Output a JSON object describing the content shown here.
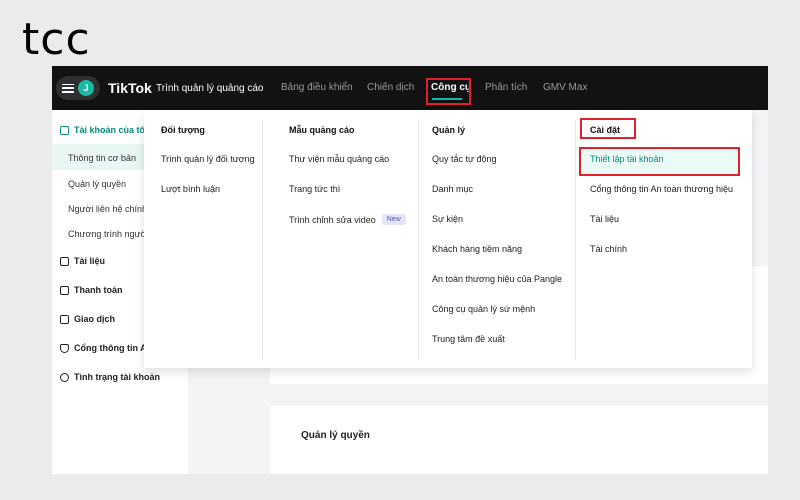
{
  "logo": "tcc",
  "header": {
    "avatar_initial": "J",
    "brand": "TikTok",
    "brand_sub": "Trình quản lý quảng cáo",
    "nav": [
      {
        "label": "Bảng điều khiển"
      },
      {
        "label": "Chiến dịch"
      },
      {
        "label": "Công cụ"
      },
      {
        "label": "Phân tích"
      },
      {
        "label": "GMV Max"
      }
    ]
  },
  "sidebar": {
    "section_title": "Tài khoản của tôi",
    "sub_items": [
      {
        "label": "Thông tin cơ bản"
      },
      {
        "label": "Quản lý quyền"
      },
      {
        "label": "Người liên hệ chính"
      },
      {
        "label": "Chương trình người"
      }
    ],
    "items": [
      {
        "label": "Tài liệu"
      },
      {
        "label": "Thanh toán"
      },
      {
        "label": "Giao dịch"
      },
      {
        "label": "Cổng thông tin A"
      },
      {
        "label": "Tình trạng tài khoản"
      }
    ]
  },
  "dropdown": {
    "columns": [
      {
        "title": "Đối tượng",
        "items": [
          "Trình quản lý đối tượng",
          "Lượt bình luận"
        ]
      },
      {
        "title": "Mẫu quảng cáo",
        "items": [
          "Thư viện mẫu quảng cáo",
          "Trang tức thì",
          "Trình chỉnh sửa video"
        ],
        "badge": "New"
      },
      {
        "title": "Quản lý",
        "items": [
          "Quy tắc tự động",
          "Danh mục",
          "Sự kiện",
          "Khách hàng tiềm năng",
          "An toàn thương hiệu của Pangle",
          "Công cụ quản lý sứ mệnh",
          "Trung tâm đề xuất"
        ]
      },
      {
        "title": "Cài đặt",
        "items": [
          "Thiết lập tài khoản",
          "Cổng thông tin An toàn thương hiệu",
          "Tài liệu",
          "Tài chính"
        ]
      }
    ]
  },
  "main": {
    "section_label": "Quản lý quyền"
  },
  "colors": {
    "accent": "#19b9a5",
    "active_text": "#0a8c7c",
    "highlight": "#e0202a",
    "topbar": "#121212"
  }
}
